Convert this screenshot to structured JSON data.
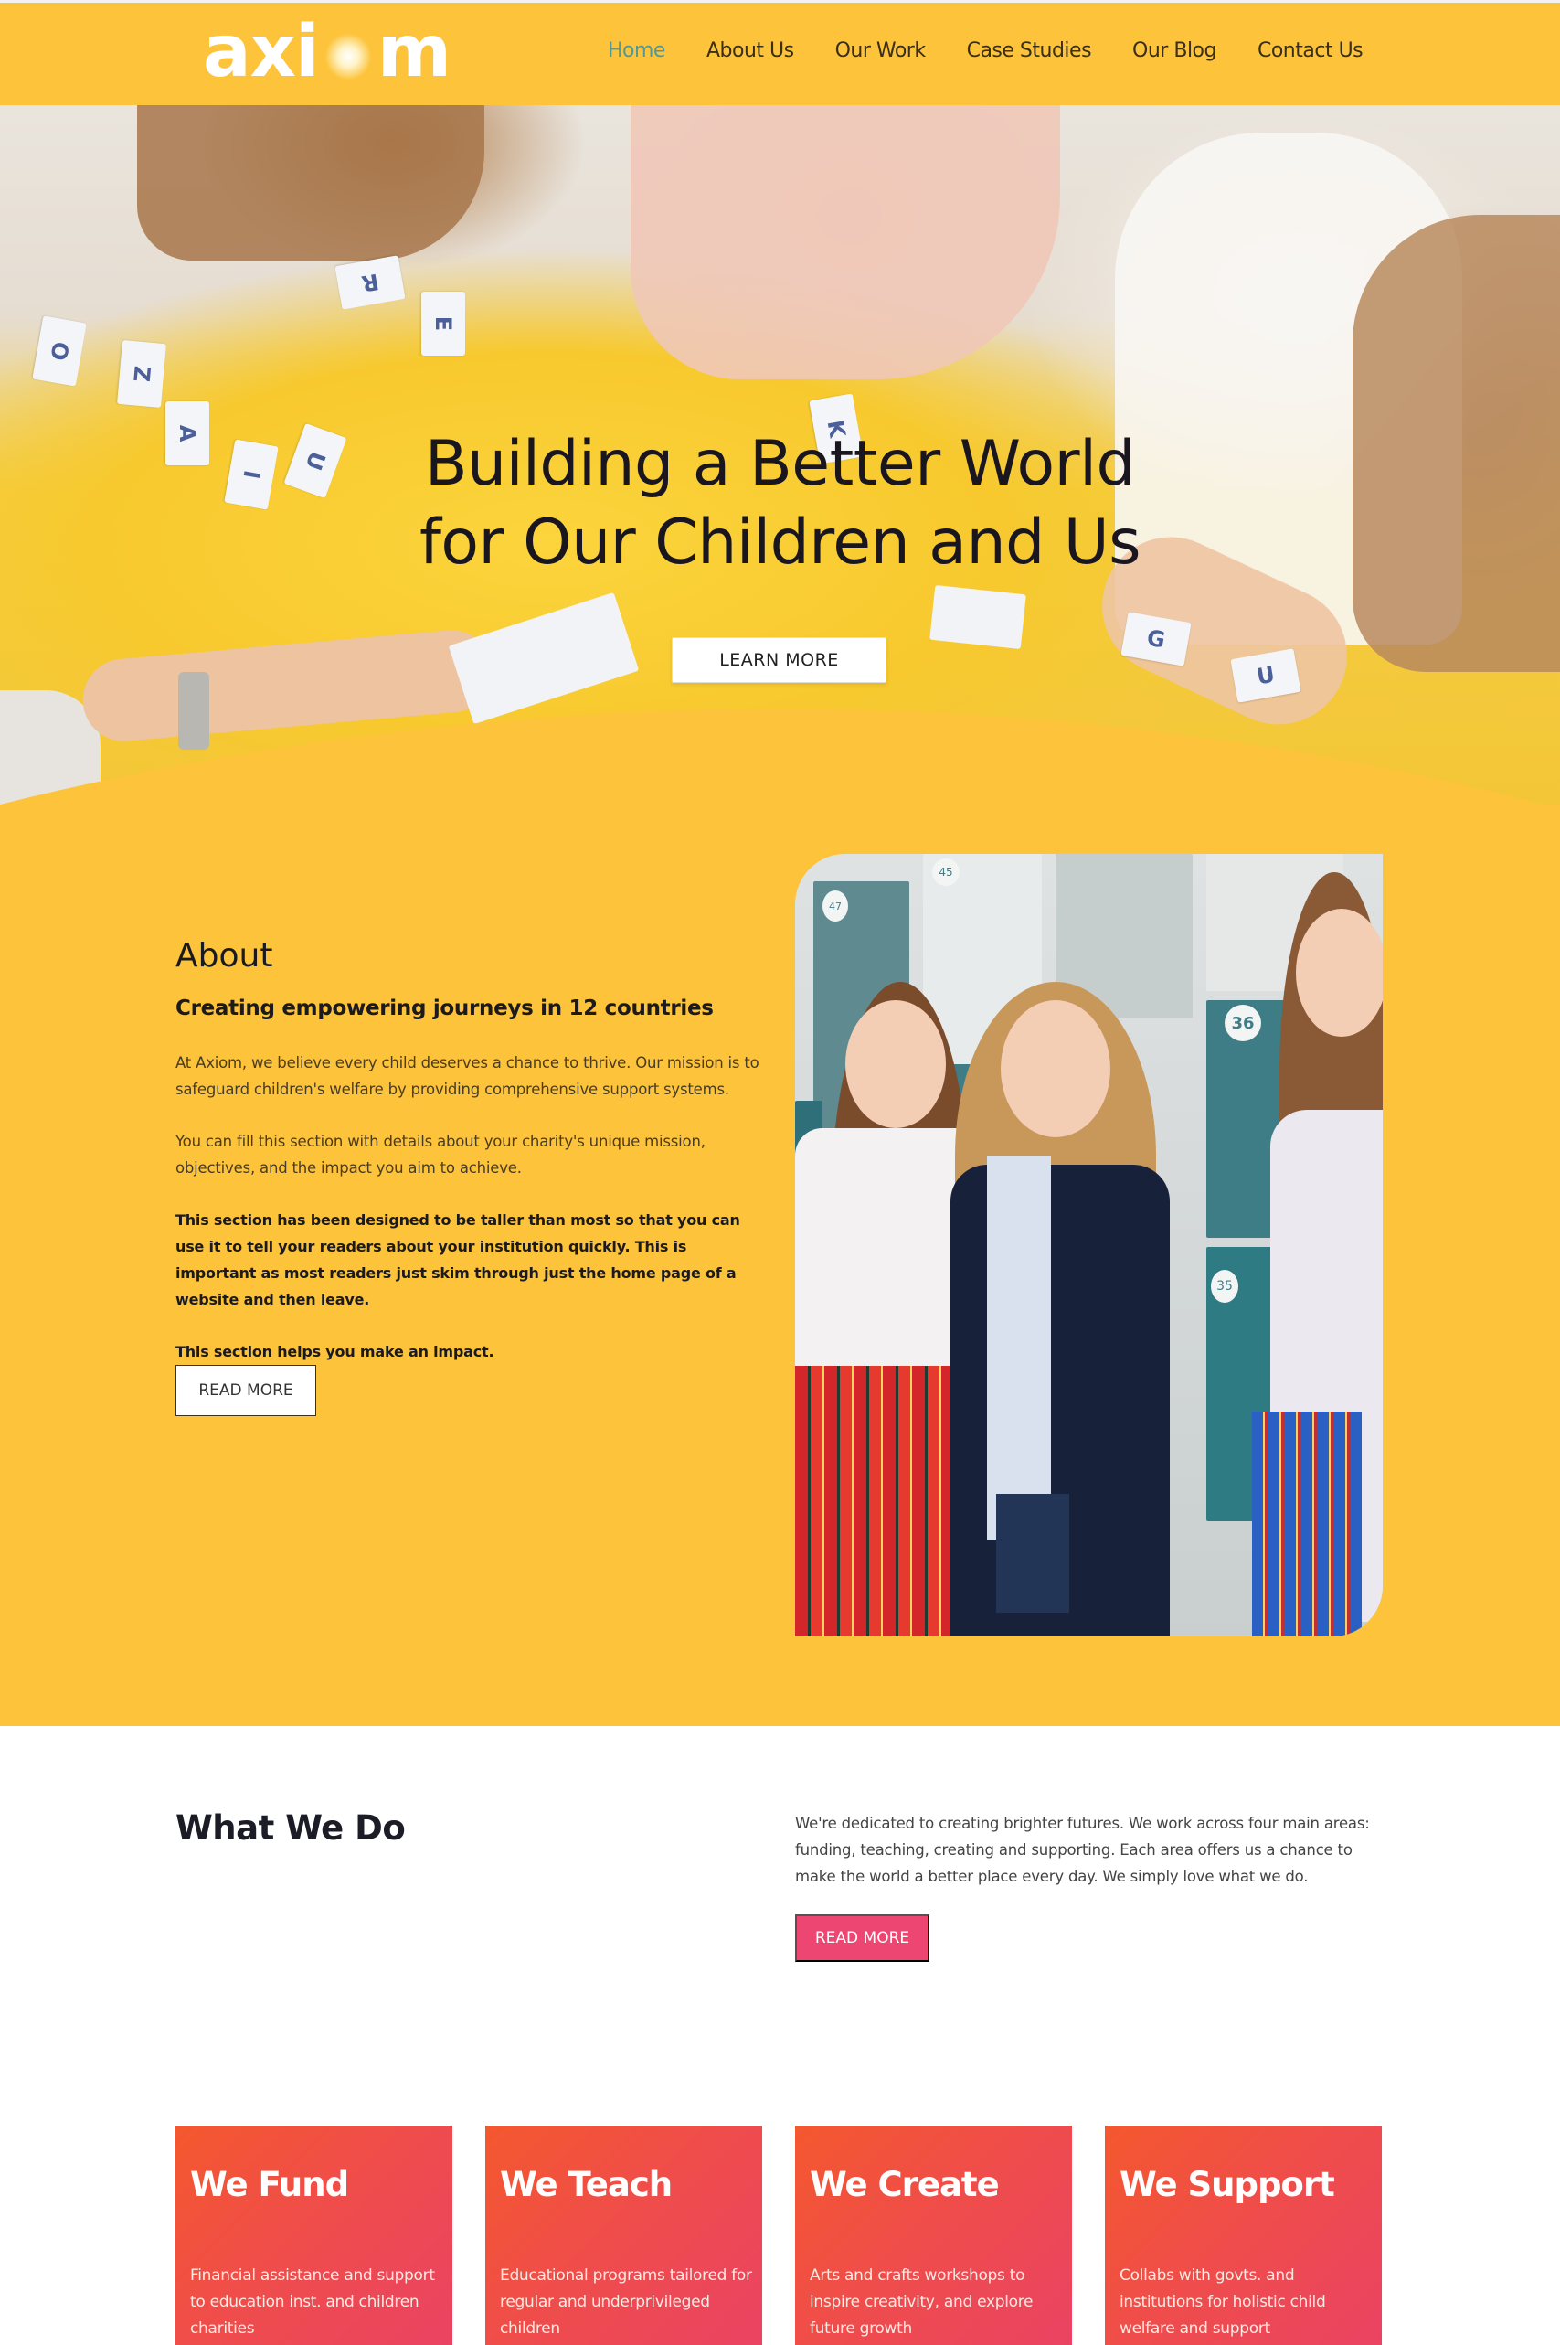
{
  "brand": {
    "logo_text_left": "axi",
    "logo_text_right": "m",
    "primary_color": "#fdc33a",
    "accent_color": "#ee4672",
    "active_nav_color": "#4f9a98"
  },
  "nav": {
    "items": [
      {
        "label": "Home",
        "active": true
      },
      {
        "label": "About Us",
        "active": false
      },
      {
        "label": "Our Work",
        "active": false
      },
      {
        "label": "Case Studies",
        "active": false
      },
      {
        "label": "Our Blog",
        "active": false
      },
      {
        "label": "Contact Us",
        "active": false
      }
    ]
  },
  "hero": {
    "title_line1": "Building a Better World",
    "title_line2": "for Our Children and Us",
    "cta_label": "LEARN MORE",
    "image_description": "children-playing-with-letter-cards-on-yellow-table",
    "letter_cards": [
      "R",
      "E",
      "O",
      "Z",
      "A",
      "I",
      "U",
      "K",
      "G",
      "U"
    ]
  },
  "about": {
    "heading": "About",
    "subheading": "Creating empowering journeys in 12 countries",
    "paragraphs": [
      "At Axiom, we believe every child deserves a chance to thrive. Our mission is to safeguard children's welfare by providing comprehensive support systems.",
      "You can fill this section with details about your charity's unique mission, objectives, and the impact you aim to achieve."
    ],
    "bold_paragraphs": [
      "This section has been designed to be taller than most so that you can use it to tell your readers about your institution quickly. This is important as most readers just skim through just the home page of a website and then leave.",
      "This section helps you make an impact."
    ],
    "button_label": "READ MORE",
    "image_description": "three-schoolgirls-smiling-in-front-of-lockers",
    "locker_numbers": [
      "45",
      "47",
      "36",
      "35"
    ]
  },
  "what_we_do": {
    "heading": "What We Do",
    "description": "We're dedicated to creating brighter futures. We work across four main areas: funding, teaching, creating and supporting. Each area offers us a chance to make the world a better place every day. We simply love what we do.",
    "button_label": "READ MORE",
    "cards": [
      {
        "title": "We Fund",
        "text": "Financial assistance and support to education inst. and children charities"
      },
      {
        "title": "We Teach",
        "text": "Educational programs tailored for regular and underprivileged children"
      },
      {
        "title": "We Create",
        "text": "Arts and crafts workshops to inspire creativity, and explore future growth"
      },
      {
        "title": "We Support",
        "text": "Collabs with govts. and institutions for holistic child welfare and support"
      }
    ]
  }
}
